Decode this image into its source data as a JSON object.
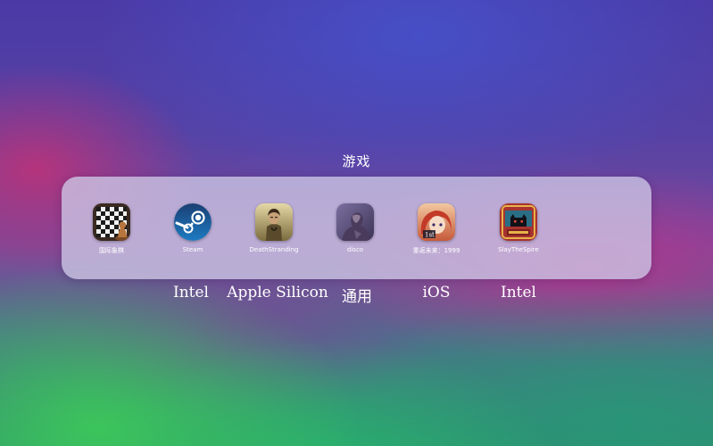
{
  "folder": {
    "title": "游戏"
  },
  "apps": [
    {
      "label": "国际象棋",
      "icon": "chess-icon"
    },
    {
      "label": "Steam",
      "icon": "steam-icon"
    },
    {
      "label": "DeathStranding",
      "icon": "death-stranding-icon"
    },
    {
      "label": "disco",
      "icon": "disco-icon"
    },
    {
      "label": "重返未来：1999",
      "icon": "reverse-1999-icon"
    },
    {
      "label": "SlayTheSpire",
      "icon": "slay-the-spire-icon"
    }
  ],
  "arch_labels": [
    "Intel",
    "Apple Silicon",
    "通用",
    "iOS",
    "Intel"
  ],
  "colors": {
    "dock": "#cdc8e6",
    "steam_blue": "#1b5fa8",
    "text": "#ffffff"
  }
}
